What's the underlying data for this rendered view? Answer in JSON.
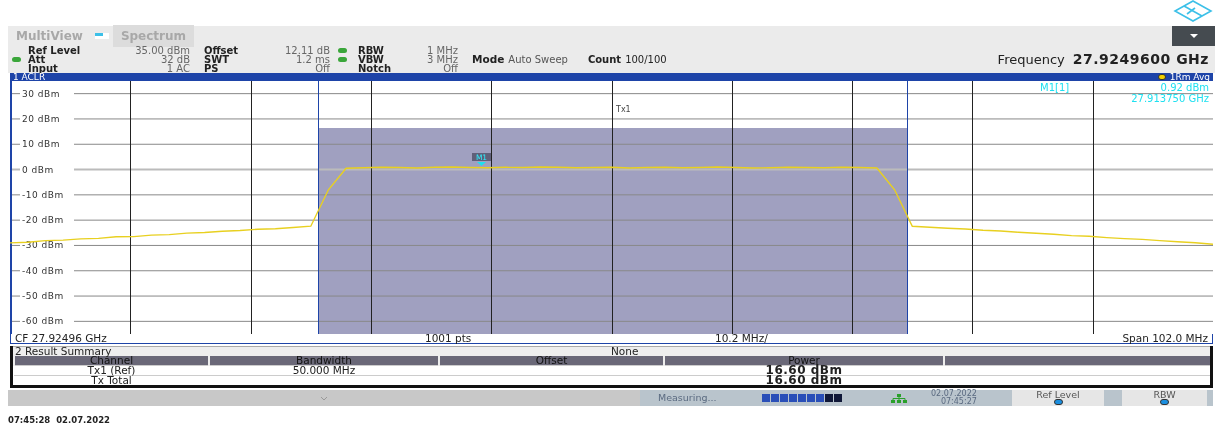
{
  "tabs": [
    {
      "label": "MultiView",
      "selected": false
    },
    {
      "label": "Spectrum",
      "selected": true
    }
  ],
  "settings": [
    {
      "label": "Ref Level",
      "value": "35.00 dBm",
      "marked": false
    },
    {
      "label": "Att",
      "value": "32 dB",
      "marked": true
    },
    {
      "label": "Input",
      "value": "1 AC",
      "marked": false
    },
    {
      "label": "Offset",
      "value": "12.11 dB",
      "marked": false
    },
    {
      "label": "SWT",
      "value": "1.2 ms",
      "marked": false
    },
    {
      "label": "PS",
      "value": "Off",
      "marked": false
    },
    {
      "label": "RBW",
      "value": "1 MHz",
      "marked": true
    },
    {
      "label": "VBW",
      "value": "3 MHz",
      "marked": true
    },
    {
      "label": "Notch",
      "value": "Off",
      "marked": false
    }
  ],
  "mode": {
    "label": "Mode",
    "value": "Auto Sweep"
  },
  "count": {
    "label": "Count",
    "value": "100/100"
  },
  "frequency": {
    "label": "Frequency",
    "value": "27.9249600 GHz"
  },
  "window": {
    "title": "1 ACLR"
  },
  "plot": {
    "chart_data": {
      "type": "line",
      "ylim": [
        -65,
        35
      ],
      "grid": true,
      "yticks": [
        {
          "value": 30,
          "label": "30 dBm"
        },
        {
          "value": 20,
          "label": "20 dBm"
        },
        {
          "value": 10,
          "label": "10 dBm"
        },
        {
          "value": 0,
          "label": "0 dBm"
        },
        {
          "value": -10,
          "label": "-10 dBm"
        },
        {
          "value": -20,
          "label": "-20 dBm"
        },
        {
          "value": -30,
          "label": "-30 dBm"
        },
        {
          "value": -40,
          "label": "-40 dBm"
        },
        {
          "value": -50,
          "label": "-50 dBm"
        },
        {
          "value": -60,
          "label": "-60 dBm"
        }
      ],
      "categories": [
        null,
        null,
        null,
        null,
        null,
        null,
        null,
        null,
        null,
        null,
        null,
        null,
        null,
        null,
        null,
        null,
        null,
        null,
        null,
        null,
        null,
        null,
        null,
        null,
        null,
        null,
        null,
        null,
        null,
        null,
        null,
        null,
        null,
        null,
        null,
        null,
        null,
        null,
        null,
        null,
        null,
        null,
        null,
        null,
        null,
        null,
        null,
        null,
        null,
        null,
        null,
        null,
        null,
        null,
        null,
        null,
        null,
        null,
        null,
        null,
        null,
        null,
        null,
        null,
        null,
        null,
        null,
        null,
        null
      ],
      "series": [
        {
          "name": "1Rm Avg",
          "color": "#e8d020",
          "values": [
            -29.0,
            -28.7,
            -28.1,
            -27.9,
            -27.4,
            -27.2,
            -26.6,
            -26.5,
            -25.9,
            -25.7,
            -25.1,
            -24.9,
            -24.4,
            -24.1,
            -23.6,
            -23.4,
            -22.9,
            -22.4,
            -8.0,
            0.5,
            0.7,
            0.9,
            0.8,
            0.6,
            0.9,
            1.0,
            0.8,
            0.7,
            0.9,
            0.8,
            1.0,
            0.9,
            0.7,
            0.8,
            0.9,
            0.6,
            0.8,
            0.9,
            0.7,
            0.8,
            1.0,
            0.8,
            0.6,
            0.7,
            0.9,
            0.8,
            0.7,
            0.9,
            0.8,
            0.6,
            -8.0,
            -22.4,
            -22.8,
            -23.2,
            -23.5,
            -24.0,
            -24.3,
            -24.8,
            -25.2,
            -25.6,
            -26.1,
            -26.4,
            -26.9,
            -27.3,
            -27.6,
            -28.1,
            -28.5,
            -28.9,
            -29.5
          ]
        }
      ]
    },
    "channel_label": "Tx1",
    "marker": {
      "label": "M1",
      "readout_name": "M1[1]",
      "readout_level": "0.92 dBm",
      "readout_frequency": "27.913750 GHz"
    }
  },
  "plot_footer": [
    "CF 27.92496 GHz",
    "1001 pts",
    "10.2 MHz/",
    "Span 102.0 MHz"
  ],
  "result_summary": {
    "title": "2 Result Summary",
    "limit_check": "None",
    "columns": [
      "Channel",
      "Bandwidth",
      "Offset",
      "Power"
    ],
    "rows": [
      {
        "channel": "Tx1 (Ref)",
        "bandwidth": "50.000 MHz",
        "power": "16.60 dBm"
      },
      {
        "channel": "Tx Total",
        "power": "16.60 dBm"
      }
    ]
  },
  "status_bar": {
    "state": "Measuring...",
    "progress": {
      "level": 0.78
    },
    "date": "02.07.2022",
    "time": "07:45:27",
    "softkeys": [
      "Ref Level",
      "RBW"
    ]
  },
  "timestamp": "07:45:28  02.07.2022"
}
